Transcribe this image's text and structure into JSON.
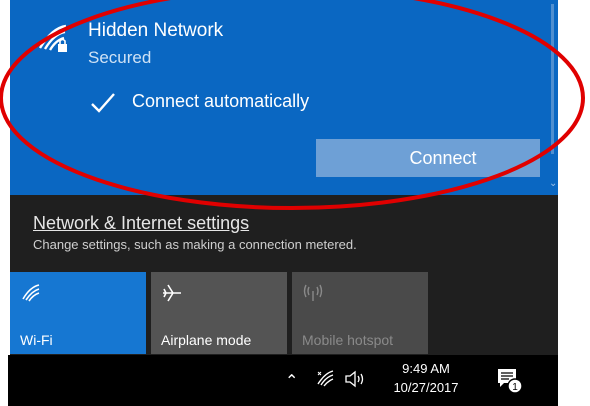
{
  "network": {
    "name": "Hidden Network",
    "status": "Secured",
    "connect_auto_label": "Connect automatically",
    "connect_auto_checked": true,
    "connect_button_label": "Connect"
  },
  "settings": {
    "link_label": "Network & Internet settings",
    "description": "Change settings, such as making a connection metered."
  },
  "quick_actions": [
    {
      "label": "Wi-Fi",
      "icon": "wifi-icon",
      "state": "on"
    },
    {
      "label": "Airplane mode",
      "icon": "airplane-icon",
      "state": "off"
    },
    {
      "label": "Mobile hotspot",
      "icon": "hotspot-icon",
      "state": "disabled"
    }
  ],
  "taskbar": {
    "time": "9:49 AM",
    "date": "10/27/2017",
    "notification_count": "1"
  },
  "colors": {
    "accent": "#0a67c2",
    "tile_on": "#1677d2",
    "annotation": "#e00000"
  }
}
